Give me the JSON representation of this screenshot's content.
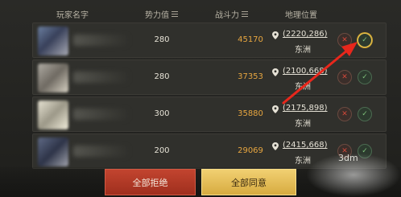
{
  "header": {
    "col_name": "玩家名字",
    "col_power": "势力值",
    "col_combat": "战斗力",
    "col_location": "地理位置"
  },
  "rows": [
    {
      "power": "280",
      "combat": "45170",
      "coords": "(2220,286)",
      "region": "东洲"
    },
    {
      "power": "280",
      "combat": "37353",
      "coords": "(2100,668)",
      "region": "东洲"
    },
    {
      "power": "300",
      "combat": "35880",
      "coords": "(2175,898)",
      "region": "东洲"
    },
    {
      "power": "200",
      "combat": "29069",
      "coords": "(2415,668)",
      "region": "东洲"
    }
  ],
  "footer": {
    "reject_all": "全部拒绝",
    "accept_all": "全部同意"
  },
  "watermark": "3dm",
  "icons": {
    "reject": "close-icon",
    "accept": "check-icon",
    "location": "location-pin-icon",
    "sort": "sort-icon",
    "annotation": "red-arrow-icon"
  },
  "colors": {
    "combat": "#e7a640",
    "reject_button": "#b83b27",
    "accept_button": "#e8c05a",
    "arrow": "#e8271c"
  }
}
